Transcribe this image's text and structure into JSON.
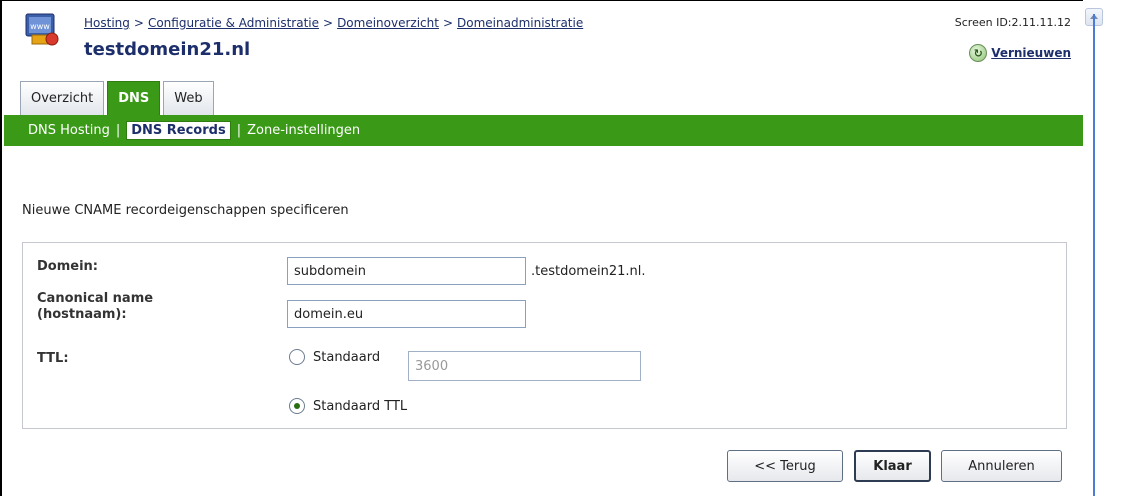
{
  "header": {
    "breadcrumb": [
      "Hosting",
      "Configuratie & Administratie",
      "Domeinoverzicht",
      "Domeinadministratie"
    ],
    "breadcrumb_separator": ">",
    "title": "testdomein21.nl",
    "screen_id": "Screen ID:2.11.11.12",
    "refresh_label": "Vernieuwen",
    "icon": "www-globe-icon"
  },
  "tabs": [
    {
      "label": "Overzicht",
      "active": false
    },
    {
      "label": "DNS",
      "active": true
    },
    {
      "label": "Web",
      "active": false
    }
  ],
  "subnav": {
    "items": [
      "DNS Hosting",
      "DNS Records",
      "Zone-instellingen"
    ],
    "active": "DNS Records",
    "separator": "|"
  },
  "form": {
    "instruction": "Nieuwe CNAME recordeigenschappen specificeren",
    "domain_label": "Domein:",
    "domain_value": "subdomein",
    "domain_suffix": ".testdomein21.nl.",
    "canonical_label_line1": "Canonical name",
    "canonical_label_line2": "(hostnaam):",
    "canonical_value": "domein.eu",
    "ttl_label": "TTL:",
    "ttl_option_custom": "Standaard",
    "ttl_custom_value": "3600",
    "ttl_option_default": "Standaard TTL",
    "ttl_selected": "Standaard TTL"
  },
  "buttons": {
    "back": "<< Terug",
    "finish": "Klaar",
    "cancel": "Annuleren"
  },
  "colors": {
    "accent_green": "#3a9a17",
    "link_blue": "#1d2f6b"
  }
}
